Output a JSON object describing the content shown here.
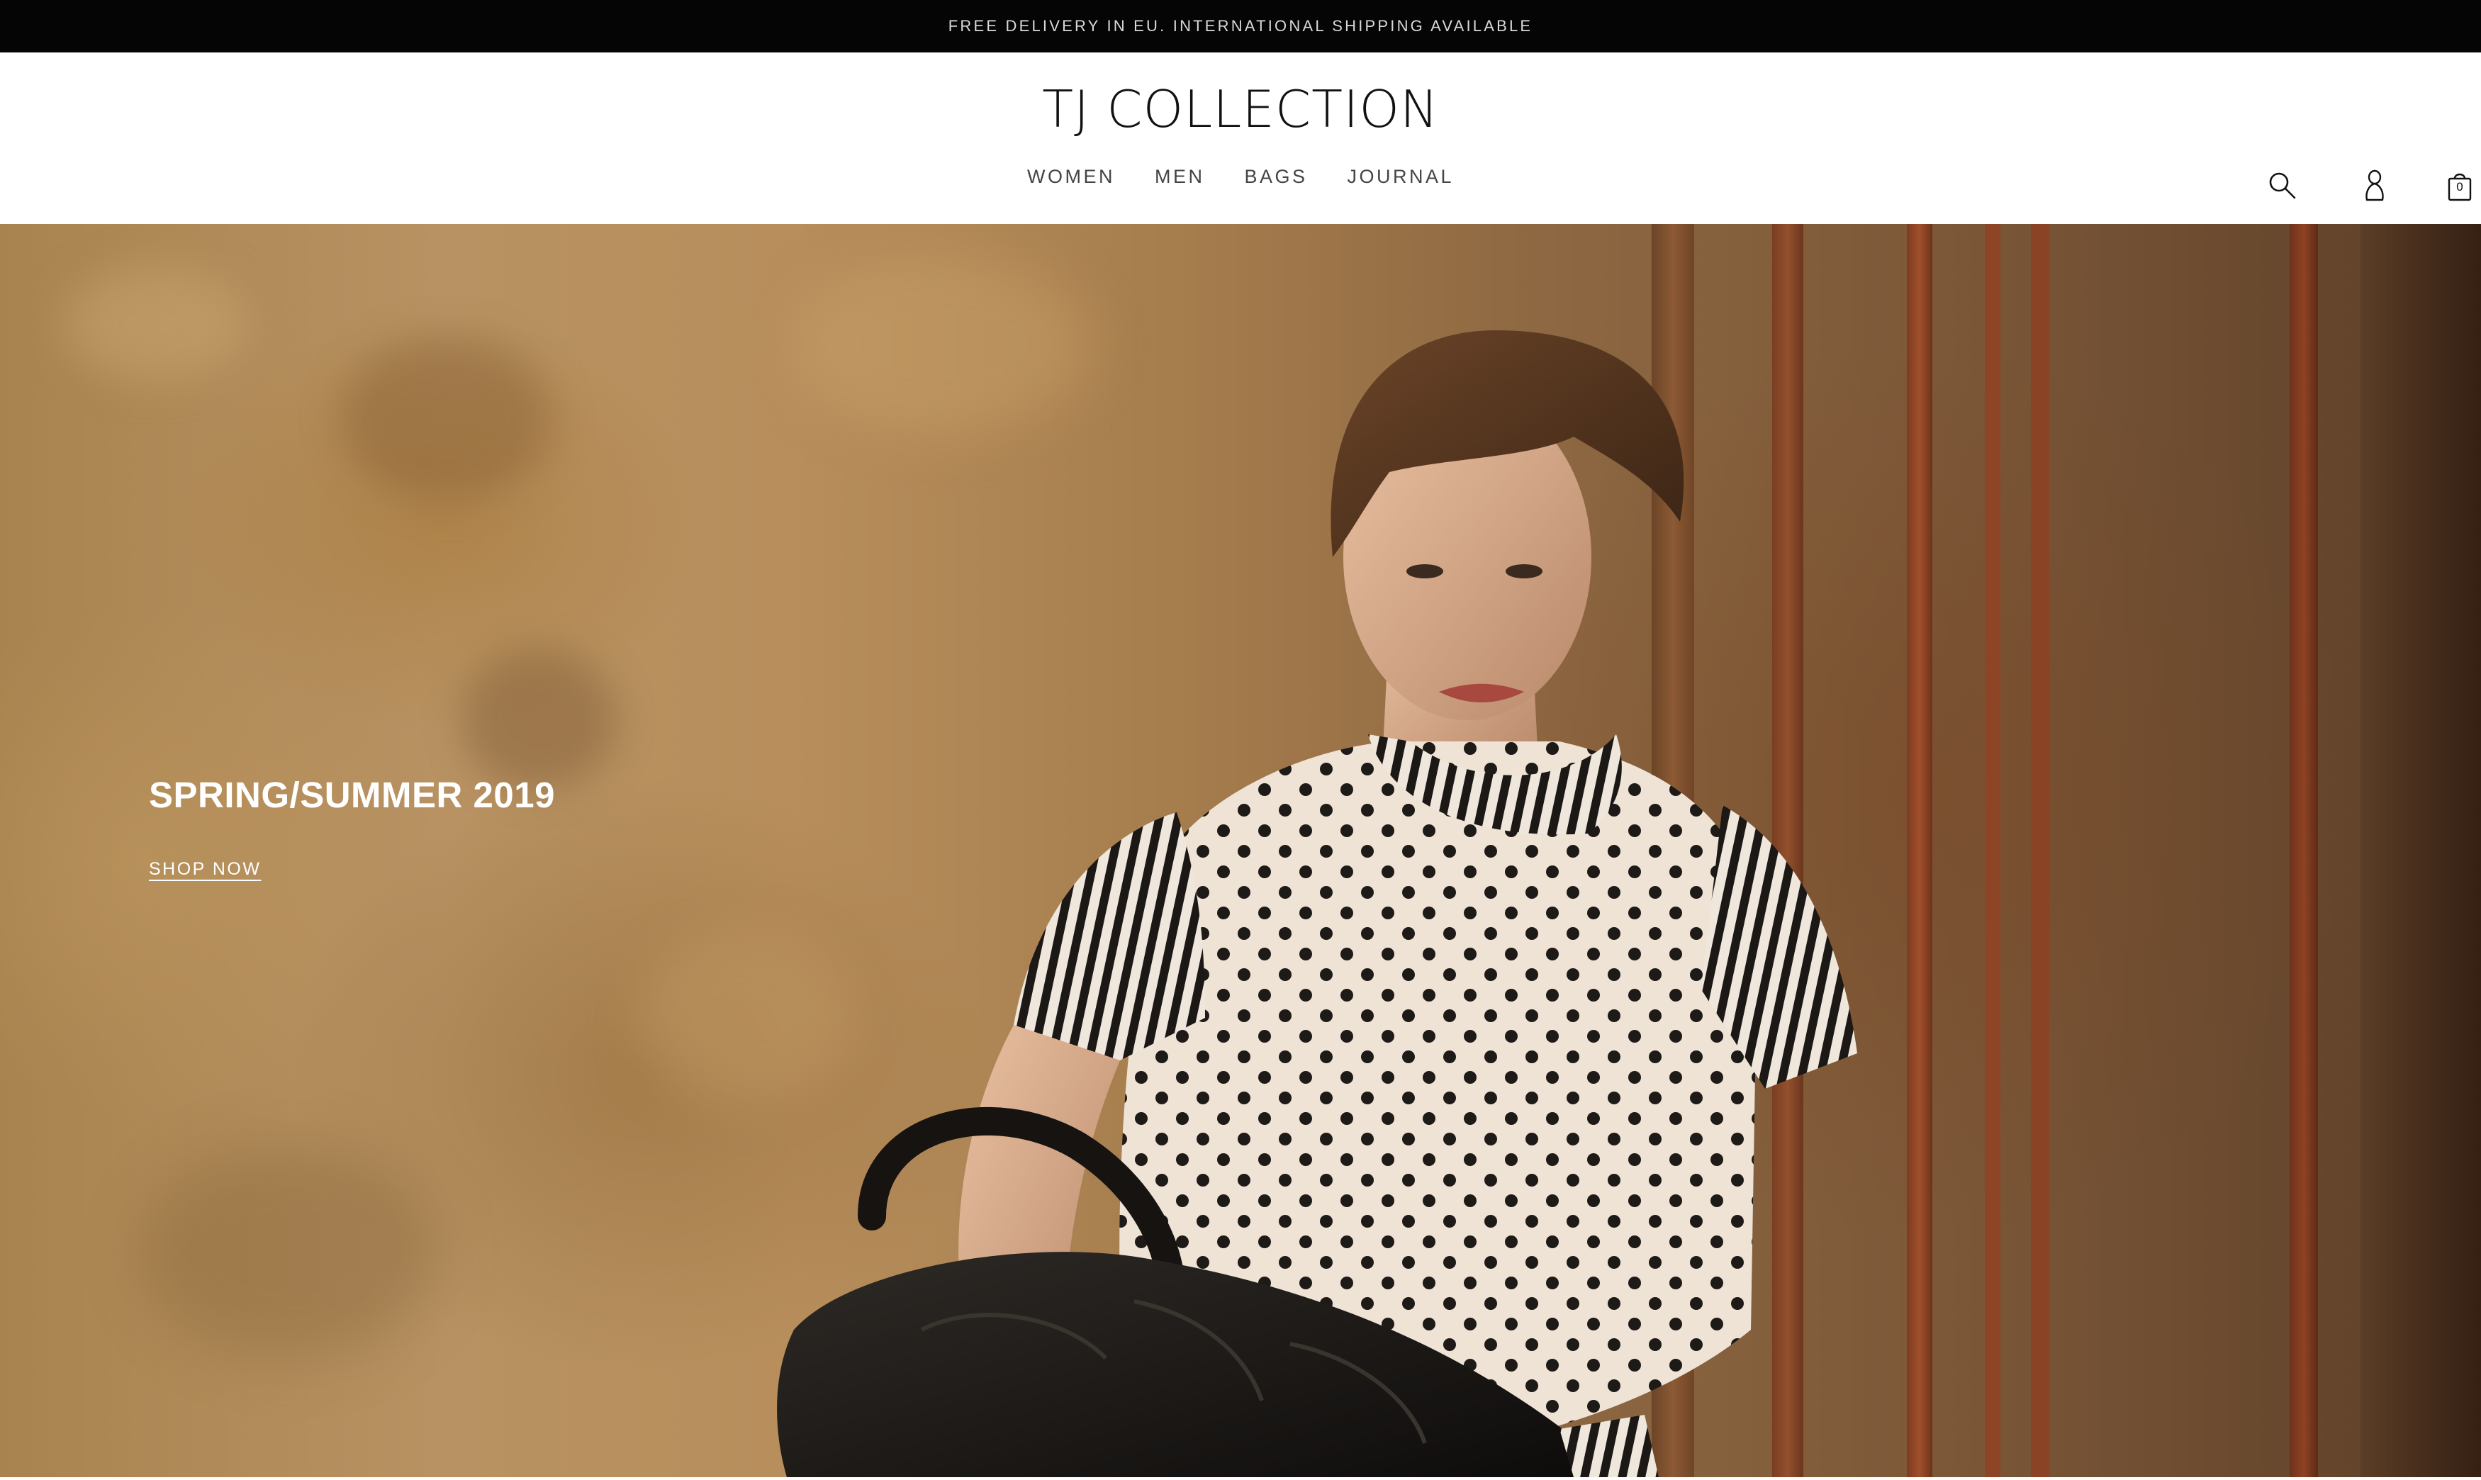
{
  "announcement": {
    "text": "FREE DELIVERY IN EU. INTERNATIONAL SHIPPING AVAILABLE"
  },
  "header": {
    "logo": "TJ COLLECTION",
    "nav": [
      {
        "label": "WOMEN"
      },
      {
        "label": "MEN"
      },
      {
        "label": "BAGS"
      },
      {
        "label": "JOURNAL"
      }
    ],
    "icons": {
      "search": "search-icon",
      "account": "account-icon",
      "cart": "shopping-bag-icon"
    },
    "cart_count": "0"
  },
  "hero": {
    "title": "SPRING/SUMMER 2019",
    "cta": "SHOP NOW"
  },
  "colors": {
    "announcement_bg": "#050505",
    "text_dark": "#111111",
    "nav_text": "#444444",
    "hero_text": "#ffffff"
  }
}
